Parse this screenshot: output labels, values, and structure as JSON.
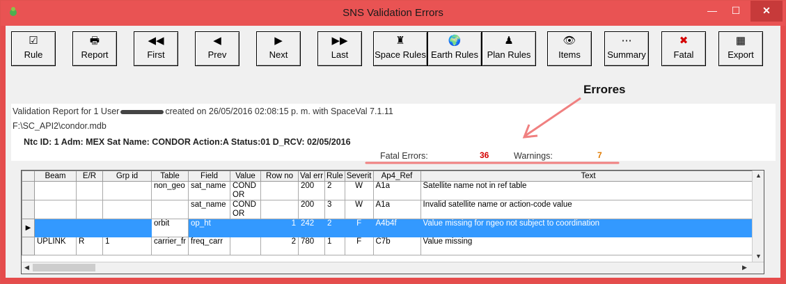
{
  "window": {
    "title": "SNS Validation Errors",
    "minimize": "—",
    "maximize": "☐",
    "close": "✕"
  },
  "toolbar": [
    {
      "label": "Rule",
      "icon": "☑"
    },
    {
      "label": "Report",
      "icon": "🖶"
    },
    {
      "label": "First",
      "icon": "◀◀"
    },
    {
      "label": "Prev",
      "icon": "◀"
    },
    {
      "label": "Next",
      "icon": "▶"
    },
    {
      "label": "Last",
      "icon": "▶▶"
    },
    {
      "label": "Space Rules",
      "icon": "♜"
    },
    {
      "label": "Earth Rules",
      "icon": "🌍"
    },
    {
      "label": "Plan Rules",
      "icon": "♟"
    },
    {
      "label": "Items",
      "icon": "👁"
    },
    {
      "label": "Summary",
      "icon": "⋯"
    },
    {
      "label": "Fatal",
      "icon": "✖"
    },
    {
      "label": "Export",
      "icon": "▦"
    }
  ],
  "annotation": "Errores",
  "report": {
    "line1_prefix": "Validation Report for 1 User",
    "line1_suffix": "created on 26/05/2016 02:08:15 p. m. with SpaceVal 7.1.11",
    "path": "F:\\SC_API2\\condor.mdb",
    "info": "Ntc ID: 1     Adm: MEX     Sat Name:  CONDOR  Action:A  Status:01    D_RCV: 02/05/2016",
    "fatal_label": "Fatal Errors:",
    "fatal_count": "36",
    "warnings_label": "Warnings:",
    "warnings_count": "7"
  },
  "grid": {
    "columns": [
      "",
      "Beam",
      "E/R",
      "Grp id",
      "Table",
      "Field",
      "Value",
      "Row no",
      "Val err",
      "Rule",
      "Severit",
      "Ap4_Ref",
      "Text"
    ],
    "rows": [
      {
        "beam": "",
        "er": "",
        "grp": "",
        "table": "non_geo",
        "field": "sat_name",
        "value": "COND OR",
        "rowno": "",
        "valerr": "200",
        "rule": "2",
        "sev": "W",
        "ref": "A1a",
        "text": "Satellite name not in ref table",
        "selected": false
      },
      {
        "beam": "",
        "er": "",
        "grp": "",
        "table": "",
        "field": "sat_name",
        "value": "COND OR",
        "rowno": "",
        "valerr": "200",
        "rule": "3",
        "sev": "W",
        "ref": "A1a",
        "text": "Invalid satellite name or action-code value",
        "selected": false
      },
      {
        "beam": "",
        "er": "",
        "grp": "",
        "table": "orbit",
        "field": "op_ht",
        "value": "",
        "rowno": "1",
        "valerr": "242",
        "rule": "2",
        "sev": "F",
        "ref": "A4b4f",
        "text": "Value missing for ngeo not subject to coordination",
        "selected": true
      },
      {
        "beam": "UPLINK",
        "er": "R",
        "grp": "1",
        "table": "carrier_fr",
        "field": "freq_carr",
        "value": "",
        "rowno": "2",
        "valerr": "780",
        "rule": "1",
        "sev": "F",
        "ref": "C7b",
        "text": "Value missing",
        "selected": false
      }
    ]
  }
}
